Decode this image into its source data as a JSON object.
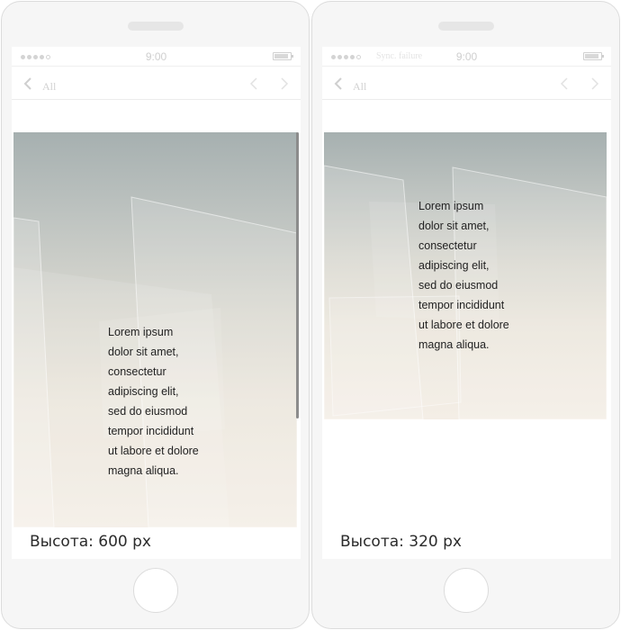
{
  "phones": [
    {
      "status": {
        "carrier": "",
        "time": "9:00"
      },
      "nav": {
        "back_label": "All"
      },
      "banner": {
        "text": "Lorem ipsum\ndolor sit amet,\nconsectetur\nadipiscing elit,\nsed do eiusmod\ntempor incididunt\nut labore et dolore\nmagna aliqua."
      },
      "caption": "Высота: 600 px"
    },
    {
      "status": {
        "carrier": "Sync. failure",
        "time": "9:00"
      },
      "nav": {
        "back_label": "All"
      },
      "banner": {
        "text": "Lorem ipsum\ndolor sit amet,\nconsectetur\nadipiscing elit,\nsed do eiusmod\ntempor incididunt\nut labore et dolore\nmagna aliqua."
      },
      "caption": "Высота: 320 px"
    }
  ],
  "icons": {
    "back": "chevron-left-icon",
    "prev": "chevron-left-icon",
    "next": "chevron-right-icon",
    "battery": "battery-icon",
    "signal": "signal-dots-icon"
  },
  "colors": {
    "device_frame": "#f6f6f6",
    "device_border": "#dcdcdc",
    "banner_top": "#a6b0b0",
    "banner_bottom": "#f4eee6",
    "text": "#222222"
  }
}
